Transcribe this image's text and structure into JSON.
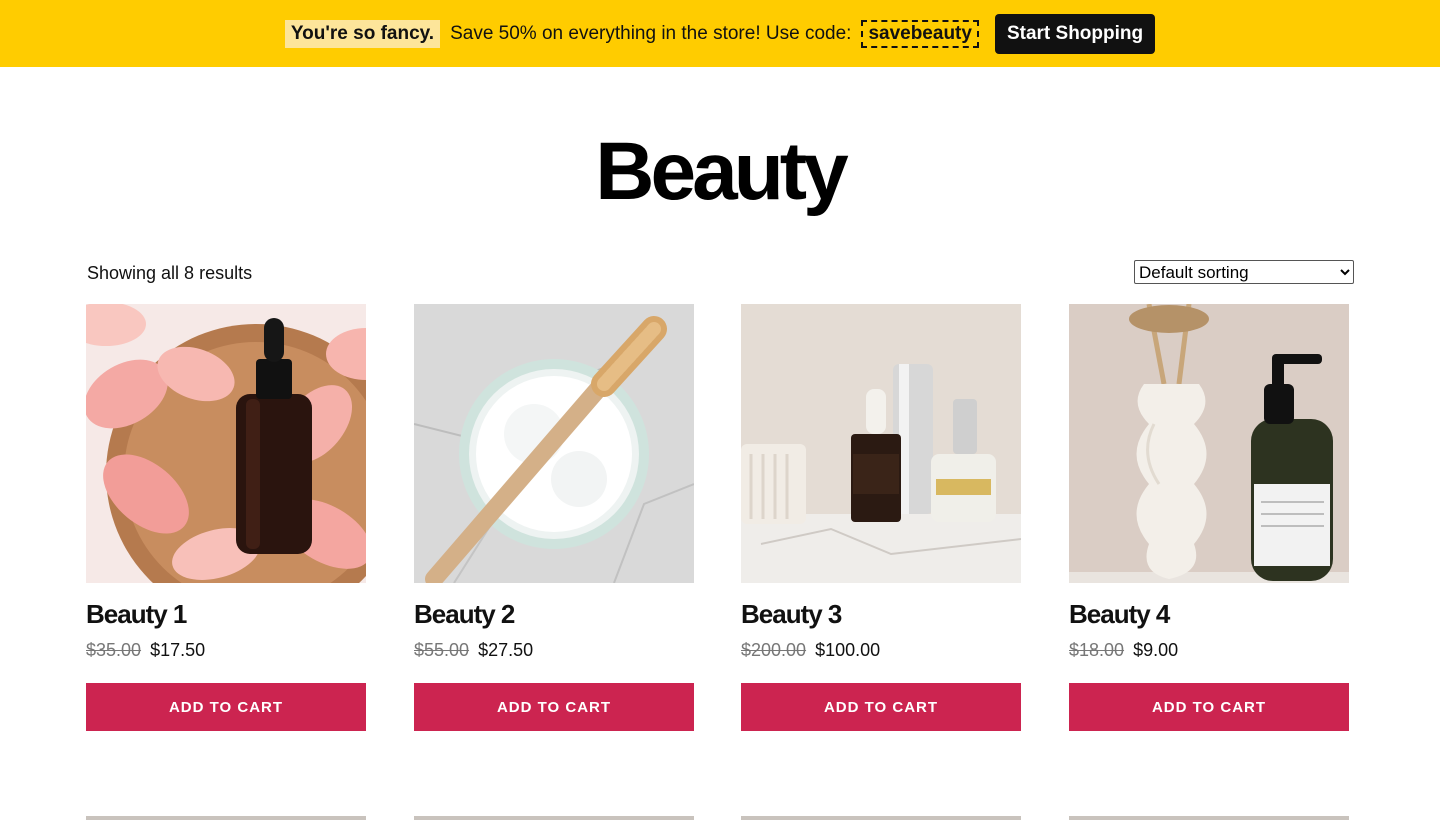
{
  "promo": {
    "highlight": "You're so fancy.",
    "text": "Save 50% on everything in the store! Use code:",
    "code": "savebeauty",
    "cta": "Start Shopping",
    "color": "#ffcc00"
  },
  "page_title": "Beauty",
  "results_count": "Showing all 8 results",
  "sort": {
    "selected": "Default sorting",
    "options": [
      "Default sorting"
    ]
  },
  "accent_color": "#cc2450",
  "products": [
    {
      "name": "Beauty 1",
      "old_price": "$35.00",
      "price": "$17.50",
      "button": "ADD TO CART",
      "image_icon": "dropper-bottle-rose-petals-image"
    },
    {
      "name": "Beauty 2",
      "old_price": "$55.00",
      "price": "$27.50",
      "button": "ADD TO CART",
      "image_icon": "bamboo-toothbrush-powder-image"
    },
    {
      "name": "Beauty 3",
      "old_price": "$200.00",
      "price": "$100.00",
      "button": "ADD TO CART",
      "image_icon": "serum-perfume-bottles-image"
    },
    {
      "name": "Beauty 4",
      "old_price": "$18.00",
      "price": "$9.00",
      "button": "ADD TO CART",
      "image_icon": "vase-lotion-pump-image"
    }
  ]
}
